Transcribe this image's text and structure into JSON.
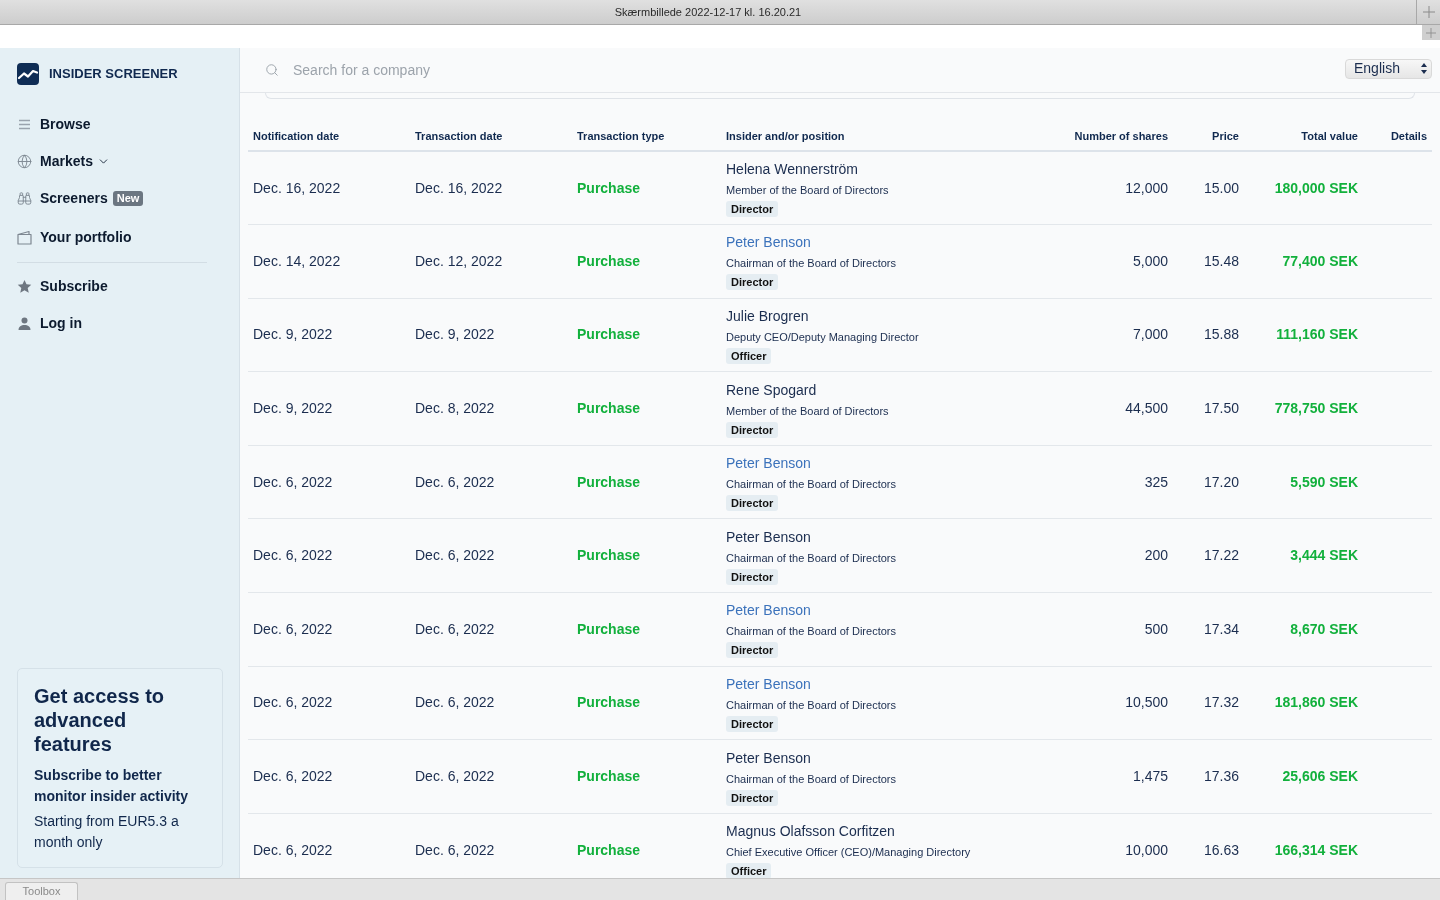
{
  "window": {
    "title": "Skærmbillede 2022-12-17 kl. 16.20.21"
  },
  "sidebar": {
    "logo_text": "INSIDER SCREENER",
    "nav_items": [
      {
        "label": "Browse",
        "kind": "link"
      },
      {
        "label": "Markets",
        "kind": "dropdown",
        "expanded": false
      },
      {
        "label": "Screeners",
        "kind": "link",
        "badge": "New"
      },
      {
        "label": "Your portfolio",
        "kind": "link"
      }
    ],
    "account_items": [
      {
        "label": "Subscribe"
      },
      {
        "label": "Log in"
      }
    ],
    "promo": {
      "heading": "Get access to advanced features",
      "subheading": "Subscribe to better monitor insider activity",
      "text": "Starting from EUR5.3 a month only"
    }
  },
  "search": {
    "placeholder": "Search for a company"
  },
  "language_select": {
    "value": "English"
  },
  "table": {
    "columns": [
      "Notification date",
      "Transaction date",
      "Transaction type",
      "Insider and/or position",
      "Number of shares",
      "Price",
      "Total value",
      "Details"
    ],
    "rows": [
      {
        "notification_date": "Dec. 16, 2022",
        "transaction_date": "Dec. 16, 2022",
        "transaction_type": "Purchase",
        "insider": "Helena Wennerström",
        "highlighted": false,
        "position": "Member of the Board of Directors",
        "role": "Director",
        "shares": "12,000",
        "price": "15.00",
        "total_value": "180,000 SEK"
      },
      {
        "notification_date": "Dec. 14, 2022",
        "transaction_date": "Dec. 12, 2022",
        "transaction_type": "Purchase",
        "insider": "Peter Benson",
        "highlighted": true,
        "position": "Chairman of the Board of Directors",
        "role": "Director",
        "shares": "5,000",
        "price": "15.48",
        "total_value": "77,400 SEK"
      },
      {
        "notification_date": "Dec. 9, 2022",
        "transaction_date": "Dec. 9, 2022",
        "transaction_type": "Purchase",
        "insider": "Julie Brogren",
        "highlighted": false,
        "position": "Deputy CEO/Deputy Managing Director",
        "role": "Officer",
        "shares": "7,000",
        "price": "15.88",
        "total_value": "111,160 SEK"
      },
      {
        "notification_date": "Dec. 9, 2022",
        "transaction_date": "Dec. 8, 2022",
        "transaction_type": "Purchase",
        "insider": "Rene Spogard",
        "highlighted": false,
        "position": "Member of the Board of Directors",
        "role": "Director",
        "shares": "44,500",
        "price": "17.50",
        "total_value": "778,750 SEK"
      },
      {
        "notification_date": "Dec. 6, 2022",
        "transaction_date": "Dec. 6, 2022",
        "transaction_type": "Purchase",
        "insider": "Peter Benson",
        "highlighted": true,
        "position": "Chairman of the Board of Directors",
        "role": "Director",
        "shares": "325",
        "price": "17.20",
        "total_value": "5,590 SEK"
      },
      {
        "notification_date": "Dec. 6, 2022",
        "transaction_date": "Dec. 6, 2022",
        "transaction_type": "Purchase",
        "insider": "Peter Benson",
        "highlighted": false,
        "position": "Chairman of the Board of Directors",
        "role": "Director",
        "shares": "200",
        "price": "17.22",
        "total_value": "3,444 SEK"
      },
      {
        "notification_date": "Dec. 6, 2022",
        "transaction_date": "Dec. 6, 2022",
        "transaction_type": "Purchase",
        "insider": "Peter Benson",
        "highlighted": true,
        "position": "Chairman of the Board of Directors",
        "role": "Director",
        "shares": "500",
        "price": "17.34",
        "total_value": "8,670 SEK"
      },
      {
        "notification_date": "Dec. 6, 2022",
        "transaction_date": "Dec. 6, 2022",
        "transaction_type": "Purchase",
        "insider": "Peter Benson",
        "highlighted": true,
        "position": "Chairman of the Board of Directors",
        "role": "Director",
        "shares": "10,500",
        "price": "17.32",
        "total_value": "181,860 SEK"
      },
      {
        "notification_date": "Dec. 6, 2022",
        "transaction_date": "Dec. 6, 2022",
        "transaction_type": "Purchase",
        "insider": "Peter Benson",
        "highlighted": false,
        "position": "Chairman of the Board of Directors",
        "role": "Director",
        "shares": "1,475",
        "price": "17.36",
        "total_value": "25,606 SEK"
      },
      {
        "notification_date": "Dec. 6, 2022",
        "transaction_date": "Dec. 6, 2022",
        "transaction_type": "Purchase",
        "insider": "Magnus Olafsson Corfitzen",
        "highlighted": false,
        "position": "Chief Executive Officer (CEO)/Managing Directory",
        "role": "Officer",
        "shares": "10,000",
        "price": "16.63",
        "total_value": "166,314 SEK"
      }
    ]
  },
  "bottom_bar": {
    "tab": "Toolbox"
  }
}
